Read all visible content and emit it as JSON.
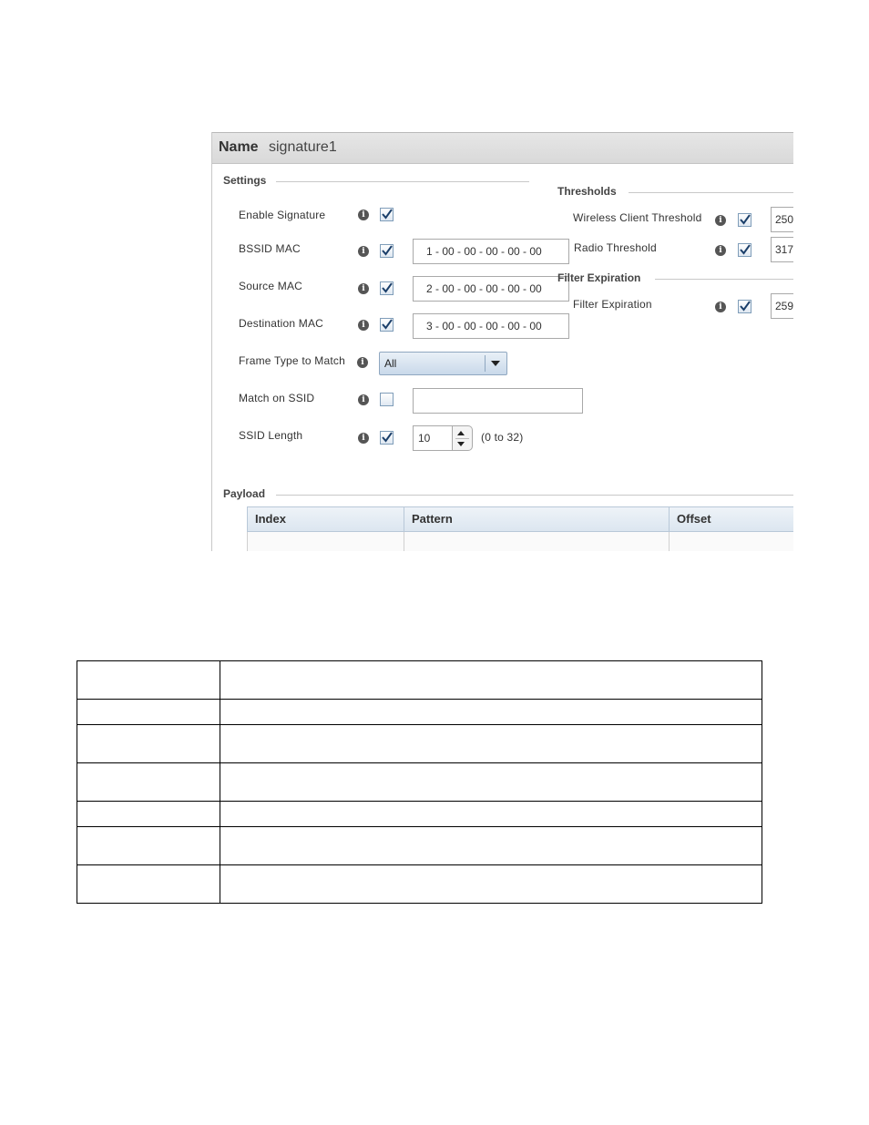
{
  "header": {
    "name_label": "Name",
    "name_value": "signature1"
  },
  "settings": {
    "title": "Settings",
    "enable_signature": {
      "label": "Enable Signature",
      "checked": true
    },
    "bssid_mac": {
      "label": "BSSID MAC",
      "checked": true,
      "value": "1 - 00 - 00 - 00 - 00 - 00"
    },
    "source_mac": {
      "label": "Source MAC",
      "checked": true,
      "value": "2 - 00 - 00 - 00 - 00 - 00"
    },
    "destination_mac": {
      "label": "Destination MAC",
      "checked": true,
      "value": "3 - 00 - 00 - 00 - 00 - 00"
    },
    "frame_type": {
      "label": "Frame Type to Match",
      "selected": "All"
    },
    "match_ssid": {
      "label": "Match on SSID",
      "checked": false,
      "value": ""
    },
    "ssid_length": {
      "label": "SSID Length",
      "checked": true,
      "value": "10",
      "range": "(0 to 32)"
    }
  },
  "thresholds": {
    "title": "Thresholds",
    "wireless_client": {
      "label": "Wireless Client Threshold",
      "checked": true,
      "value": "250"
    },
    "radio": {
      "label": "Radio Threshold",
      "checked": true,
      "value": "317"
    }
  },
  "filter_expiration": {
    "title": "Filter Expiration",
    "filter": {
      "label": "Filter Expiration",
      "checked": true,
      "value": "259"
    }
  },
  "payload": {
    "title": "Payload",
    "columns": [
      "Index",
      "Pattern",
      "Offset"
    ]
  },
  "icons": {
    "info": "info-icon",
    "check": "checkmark-icon",
    "dropdown": "chevron-down-icon"
  }
}
